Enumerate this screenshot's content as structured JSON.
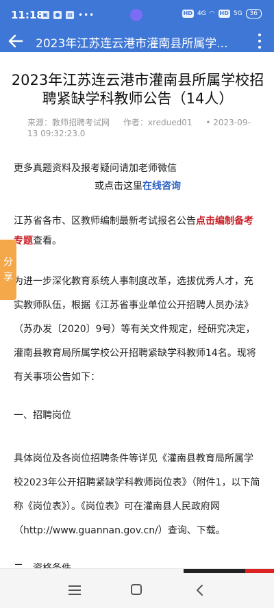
{
  "status_bar": {
    "time": "11:18",
    "battery": "36",
    "network_left": "4G",
    "network_right": "5G"
  },
  "app_bar": {
    "title": "2023年江苏连云港市灌南县所属学..."
  },
  "article": {
    "title": "2023年江苏连云港市灌南县所属学校招聘紧缺学科教师公告（14人）",
    "source": "来源：教师招聘考试网",
    "author": "作者：xredued01",
    "date": "• 2023-09-13 09:32:23.0",
    "wechat_line": "更多真题资料及报考疑问请加老师微信",
    "consult_prefix": "或点击这里",
    "consult_link": "在线咨询",
    "notice_prefix": "江苏省各市、区教师编制最新考试报名公告",
    "notice_link": "点击编制备考专题",
    "notice_suffix": "查看。",
    "intro": "为进一步深化教育系统人事制度改革，选拔优秀人才，充实教师队伍，根据《江苏省事业单位公开招聘人员办法》（苏办发〔2020〕9号）等有关文件规定，经研究决定，灌南县教育局所属学校公开招聘紧缺学科教师14名。现将有关事项公告如下：",
    "section1": "一、招聘岗位",
    "positions": "具体岗位及各岗位招聘条件等详见《灌南县教育局所属学校2023年公开招聘紧缺学科教师岗位表》（附件1，以下简称《岗位表》）。《岗位表》可在灌南县人民政府网（http://www.guannan.gov.cn/）查询、下载。",
    "section2": "二、资格条件"
  },
  "share": {
    "label": "分享"
  }
}
